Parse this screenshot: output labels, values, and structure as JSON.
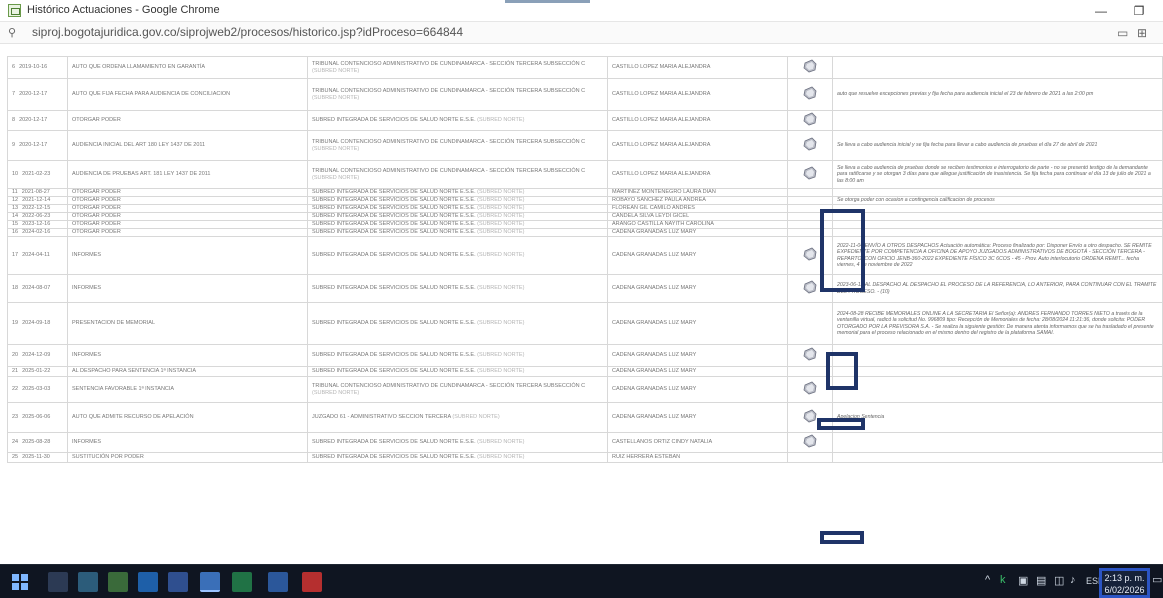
{
  "window": {
    "title": "Histórico Actuaciones - Google Chrome",
    "minimize_glyph": "—",
    "restore_glyph": "❐"
  },
  "address_bar": {
    "url": "siproj.bogotajuridica.gov.co/siprojweb2/procesos/historico.jsp?idProceso=664844"
  },
  "table": {
    "rows": [
      {
        "num": "6",
        "date": "2019-10-16",
        "action": "AUTO QUE ORDENA LLAMAMIENTO EN GARANTÍA",
        "despacho": "TRIBUNAL CONTENCIOSO ADMINISTRATIVO DE CUNDINAMARCA - SECCIÓN TERCERA SUBSECCIÓN C",
        "despacho_tag": "(SUBRED NORTE)",
        "ponente": "CASTILLO LOPEZ MARIA ALEJANDRA",
        "icon": true,
        "annotation": ""
      },
      {
        "num": "7",
        "date": "2020-12-17",
        "action": "AUTO QUE FIJA FECHA PARA AUDIENCIA DE CONCILIACION",
        "despacho": "TRIBUNAL CONTENCIOSO ADMINISTRATIVO DE CUNDINAMARCA - SECCIÓN TERCERA SUBSECCIÓN C",
        "despacho_tag": "(SUBRED NORTE)",
        "ponente": "CASTILLO LOPEZ MARIA ALEJANDRA",
        "icon": true,
        "annotation": "auto que resuelve excepciones previas y fija fecha para audiencia inicial el 23 de febrero de 2021 a las 2:00 pm"
      },
      {
        "num": "8",
        "date": "2020-12-17",
        "action": "OTORGAR PODER",
        "despacho": "SUBRED INTEGRADA DE SERVICIOS DE SALUD NORTE E.S.E.",
        "despacho_tag": "(SUBRED NORTE)",
        "ponente": "CASTILLO LOPEZ MARIA ALEJANDRA",
        "icon": true,
        "annotation": ""
      },
      {
        "num": "9",
        "date": "2020-12-17",
        "action": "AUDIENCIA INICIAL DEL ART 180 LEY 1437 DE 2011",
        "despacho": "TRIBUNAL CONTENCIOSO ADMINISTRATIVO DE CUNDINAMARCA - SECCIÓN TERCERA SUBSECCIÓN C",
        "despacho_tag": "(SUBRED NORTE)",
        "ponente": "CASTILLO LOPEZ MARIA ALEJANDRA",
        "icon": true,
        "annotation": "Se lleva a cabo audiencia inicial y se fija fecha para llevar a cabo audiencia de pruebas el día 27 de abril de 2021"
      },
      {
        "num": "10",
        "date": "2021-02-23",
        "action": "AUDIENCIA DE PRUEBAS ART. 181 LEY 1437 DE 2011",
        "despacho": "TRIBUNAL CONTENCIOSO ADMINISTRATIVO DE CUNDINAMARCA - SECCIÓN TERCERA SUBSECCIÓN C",
        "despacho_tag": "(SUBRED NORTE)",
        "ponente": "CASTILLO LOPEZ MARIA ALEJANDRA",
        "icon": true,
        "annotation": "Se lleva a cabo audiencia de pruebas donde se reciben testimonios e interrogatorio de parte - no se presentó testigo de la demandante para ratificarse y se otorgan 3 días para que allegue justificación de inasistencia. Se fija fecha para continuar el día 13 de julio de 2021 a las 8:00 am"
      },
      {
        "num": "11",
        "date": "2021-08-27",
        "action": "OTORGAR PODER",
        "despacho": "SUBRED INTEGRADA DE SERVICIOS DE SALUD NORTE E.S.E.",
        "despacho_tag": "(SUBRED NORTE)",
        "ponente": "MARTINEZ MONTENEGRO LAURA DIAN",
        "icon": false,
        "annotation": ""
      },
      {
        "num": "12",
        "date": "2021-12-14",
        "action": "OTORGAR PODER",
        "despacho": "SUBRED INTEGRADA DE SERVICIOS DE SALUD NORTE E.S.E.",
        "despacho_tag": "(SUBRED NORTE)",
        "ponente": "ROBAYO SANCHEZ PAULA ANDREA",
        "icon": false,
        "annotation": "Se otorga poder con ocasion a contingencia calificacion de procesos"
      },
      {
        "num": "13",
        "date": "2022-12-15",
        "action": "OTORGAR PODER",
        "despacho": "SUBRED INTEGRADA DE SERVICIOS DE SALUD NORTE E.S.E.",
        "despacho_tag": "(SUBRED NORTE)",
        "ponente": "FLOREAN GIL CAMILO ANDRES",
        "icon": false,
        "annotation": ""
      },
      {
        "num": "14",
        "date": "2022-06-23",
        "action": "OTORGAR PODER",
        "despacho": "SUBRED INTEGRADA DE SERVICIOS DE SALUD NORTE E.S.E.",
        "despacho_tag": "(SUBRED NORTE)",
        "ponente": "CANDELA SILVA LEYDI GICEL",
        "icon": false,
        "annotation": ""
      },
      {
        "num": "15",
        "date": "2023-12-16",
        "action": "OTORGAR PODER",
        "despacho": "SUBRED INTEGRADA DE SERVICIOS DE SALUD NORTE E.S.E.",
        "despacho_tag": "(SUBRED NORTE)",
        "ponente": "ARANGO CASTILLA NAYITH CAROLINA",
        "icon": false,
        "annotation": ""
      },
      {
        "num": "16",
        "date": "2024-02-16",
        "action": "OTORGAR PODER",
        "despacho": "SUBRED INTEGRADA DE SERVICIOS DE SALUD NORTE E.S.E.",
        "despacho_tag": "(SUBRED NORTE)",
        "ponente": "CADENA GRANADAS LUZ MARY",
        "icon": false,
        "annotation": ""
      },
      {
        "num": "17",
        "date": "2024-04-11",
        "action": "INFORMES",
        "despacho": "SUBRED INTEGRADA DE SERVICIOS DE SALUD NORTE E.S.E.",
        "despacho_tag": "(SUBRED NORTE)",
        "ponente": "CADENA GRANADAS LUZ MARY",
        "icon": true,
        "annotation": "2022-11-04 ENVÍO A OTROS DESPACHOS Actuación automática: Proceso finalizado por: Disponer Envío a otro despacho. SE REMITE EXPEDIENTE POR COMPETENCIA A OFICINA DE APOYO JUZGADOS ADMINISTRATIVOS DE BOGOTÁ - SECCIÓN TERCERA - REPARTO, CON OFICIO JENB-360-2022 EXPEDIENTE FÍSICO 3C 6COS - 45 - Prov. Auto interlocutorio ORDENA REMIT... fecha viernes, 4 de noviembre de 2022"
      },
      {
        "num": "18",
        "date": "2024-08-07",
        "action": "INFORMES",
        "despacho": "SUBRED INTEGRADA DE SERVICIOS DE SALUD NORTE E.S.E.",
        "despacho_tag": "(SUBRED NORTE)",
        "ponente": "CADENA GRANADAS LUZ MARY",
        "icon": true,
        "annotation": "2023-06-12 AL DESPACHO AL DESPACHO EL PROCESO DE LA REFERENCIA, LO ANTERIOR, PARA CONTINUAR CON EL TRAMITE DEL PROCESO. - (10)"
      },
      {
        "num": "19",
        "date": "2024-09-18",
        "action": "PRESENTACION DE MEMORIAL",
        "despacho": "SUBRED INTEGRADA DE SERVICIOS DE SALUD NORTE E.S.E.",
        "despacho_tag": "(SUBRED NORTE)",
        "ponente": "CADENA GRANADAS LUZ MARY",
        "icon": false,
        "annotation": "2024-08-28 RECIBE MEMORIALES ONLINE A LA SECRETARIA El Señor(a): ANDRES FERNANDO TORRES NIETO a través de la ventanilla virtual, radicó la solicitud No. 996809 tipo: Recepción de Memoriales de fecha: 28/08/2024 11:21:36, donde solicita: PODER OTORGADO POR LA PREVISORA S.A. - Se realiza la siguiente gestión: De manera atenta informamos que se ha trasladado el presente memorial para el proceso relacionado en el mismo dentro del registro de la plataforma SAMAI."
      },
      {
        "num": "20",
        "date": "2024-12-09",
        "action": "INFORMES",
        "despacho": "SUBRED INTEGRADA DE SERVICIOS DE SALUD NORTE E.S.E.",
        "despacho_tag": "(SUBRED NORTE)",
        "ponente": "CADENA GRANADAS LUZ MARY",
        "icon": true,
        "annotation": ""
      },
      {
        "num": "21",
        "date": "2025-01-22",
        "action": "AL DESPACHO PARA SENTENCIA 1ª INSTANCIA",
        "despacho": "SUBRED INTEGRADA DE SERVICIOS DE SALUD NORTE E.S.E.",
        "despacho_tag": "(SUBRED NORTE)",
        "ponente": "CADENA GRANADAS LUZ MARY",
        "icon": false,
        "annotation": ""
      },
      {
        "num": "22",
        "date": "2025-03-03",
        "action": "SENTENCIA FAVORABLE 1ª INSTANCIA",
        "despacho": "TRIBUNAL CONTENCIOSO ADMINISTRATIVO DE CUNDINAMARCA - SECCIÓN TERCERA SUBSECCIÓN C",
        "despacho_tag": "(SUBRED NORTE)",
        "ponente": "CADENA GRANADAS LUZ MARY",
        "icon": true,
        "annotation": ""
      },
      {
        "num": "23",
        "date": "2025-06-06",
        "action": "AUTO QUE ADMITE RECURSO DE APELACIÓN",
        "despacho": "JUZGADO 61 - ADMINISTRATIVO SECCION TERCERA",
        "despacho_tag": "(SUBRED NORTE)",
        "ponente": "CADENA GRANADAS LUZ MARY",
        "icon": true,
        "annotation": "Apelacion Sentencia"
      },
      {
        "num": "24",
        "date": "2025-08-28",
        "action": "INFORMES",
        "despacho": "SUBRED INTEGRADA DE SERVICIOS DE SALUD NORTE E.S.E.",
        "despacho_tag": "(SUBRED NORTE)",
        "ponente": "CASTELLANOS ORTIZ CINDY NATALIA",
        "icon": true,
        "annotation": ""
      },
      {
        "num": "25",
        "date": "2025-11-30",
        "action": "SUSTITUCIÓN POR PODER",
        "despacho": "SUBRED INTEGRADA DE SERVICIOS DE SALUD NORTE E.S.E.",
        "despacho_tag": "(SUBRED NORTE)",
        "ponente": "RUIZ HERRERA ESTEBAN",
        "icon": false,
        "annotation": ""
      }
    ]
  },
  "taskbar": {
    "tray_lang": "ESP",
    "clock_time": "2:13 p. m.",
    "clock_date": "6/02/2026"
  },
  "colors": {
    "highlight_box": "#1f3468",
    "taskbar": "#0f1521"
  }
}
